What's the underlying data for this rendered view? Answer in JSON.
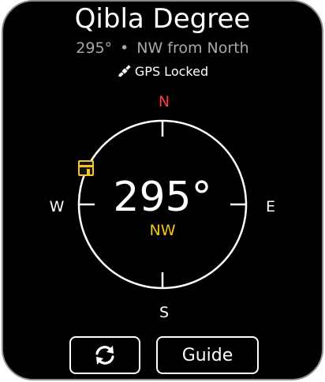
{
  "header": {
    "title": "Qibla Degree",
    "subtitle_degree": "295°",
    "subtitle_separator": "•",
    "subtitle_direction": "NW from North",
    "gps_status": "GPS Locked"
  },
  "compass": {
    "north": "N",
    "south": "S",
    "east": "E",
    "west": "W",
    "degree": "295°",
    "cardinal": "NW",
    "qibla_bearing_deg": 295
  },
  "buttons": {
    "refresh_icon": "refresh-icon",
    "guide_label": "Guide"
  },
  "colors": {
    "north": "#ff3b3b",
    "accent": "#f5c518",
    "background": "#000000",
    "text": "#ffffff",
    "muted": "#a9a9a9"
  }
}
